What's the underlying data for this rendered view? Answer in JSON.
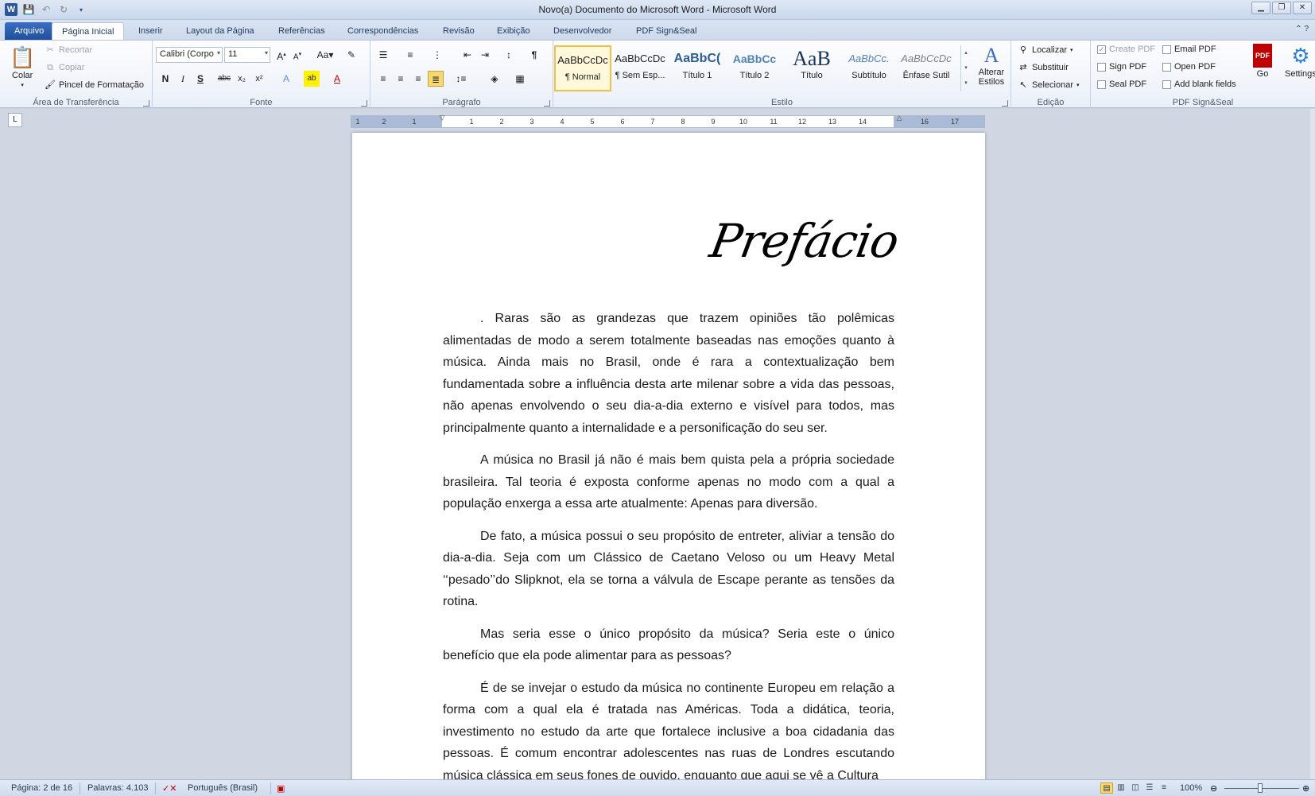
{
  "window": {
    "title": "Novo(a) Documento do Microsoft Word - Microsoft Word",
    "controls": [
      "▁",
      "❐",
      "✕"
    ]
  },
  "tabs": {
    "file": "Arquivo",
    "items": [
      "Página Inicial",
      "Inserir",
      "Layout da Página",
      "Referências",
      "Correspondências",
      "Revisão",
      "Exibição",
      "Desenvolvedor",
      "PDF Sign&Seal"
    ]
  },
  "clipboard": {
    "paste": "Colar",
    "cut": "Recortar",
    "copy": "Copiar",
    "format_painter": "Pincel de Formatação",
    "label": "Área de Transferência"
  },
  "font": {
    "name": "Calibri (Corpo",
    "size": "11",
    "label": "Fonte",
    "bold": "N",
    "italic": "I",
    "underline": "S"
  },
  "paragraph": {
    "label": "Parágrafo"
  },
  "styles": {
    "label": "Estilo",
    "items": [
      {
        "preview": "AaBbCcDc",
        "name": "¶ Normal"
      },
      {
        "preview": "AaBbCcDc",
        "name": "¶ Sem Esp..."
      },
      {
        "preview": "AaBbC(",
        "name": "Título 1"
      },
      {
        "preview": "AaBbCc",
        "name": "Título 2"
      },
      {
        "preview": "AaB",
        "name": "Título"
      },
      {
        "preview": "AaBbCc.",
        "name": "Subtítulo"
      },
      {
        "preview": "AaBbCcDc",
        "name": "Ênfase Sutil"
      }
    ],
    "change_styles": "Alterar Estilos"
  },
  "editing": {
    "label": "Edição",
    "find": "Localizar",
    "replace": "Substituir",
    "select": "Selecionar"
  },
  "pdf": {
    "label": "PDF Sign&Seal",
    "create": "Create PDF",
    "sign": "Sign PDF",
    "seal": "Seal PDF",
    "email": "Email PDF",
    "open": "Open PDF",
    "blank": "Add blank fields",
    "go": "Go",
    "settings": "Settings"
  },
  "ruler": {
    "ticks": [
      "1",
      "2",
      "1",
      "1",
      "2",
      "3",
      "4",
      "5",
      "6",
      "7",
      "8",
      "9",
      "10",
      "11",
      "12",
      "13",
      "14",
      "16",
      "17"
    ]
  },
  "document": {
    "heading": "Prefácio",
    "paragraphs": [
      ". Raras são as grandezas que trazem opiniões tão polêmicas alimentadas de modo a serem totalmente baseadas nas emoções quanto à música. Ainda mais no Brasil, onde é rara a contextualização bem fundamentada sobre a influência desta arte milenar sobre a vida das pessoas, não apenas envolvendo o seu dia-a-dia externo e visível para todos, mas principalmente quanto a internalidade e a personificação do seu ser.",
      "A música no Brasil já não é mais bem quista pela a própria sociedade brasileira. Tal teoria é exposta conforme apenas no modo com a qual a população enxerga a essa arte atualmente: Apenas para diversão.",
      "De fato, a música possui o seu propósito de entreter, aliviar a tensão do dia-a-dia. Seja com um Clássico de Caetano Veloso ou um Heavy Metal ‘‘pesado’’do Slipknot, ela se torna a válvula de Escape perante as tensões da rotina.",
      "Mas seria esse o único propósito da música? Seria este o único benefício que ela pode alimentar para as pessoas?",
      "É de se invejar o estudo da música no continente Europeu em relação a forma com a qual ela é tratada nas Américas. Toda a didática, teoria, investimento no estudo da arte que fortalece inclusive a boa cidadania das pessoas. É comum encontrar adolescentes nas ruas de Londres escutando música clássica em seus fones de ouvido, enquanto que aqui se vê a Cultura"
    ]
  },
  "status": {
    "page": "Página: 2 de 16",
    "words": "Palavras: 4.103",
    "language": "Português (Brasil)",
    "zoom": "100%",
    "zoom_level_percent": 100
  }
}
